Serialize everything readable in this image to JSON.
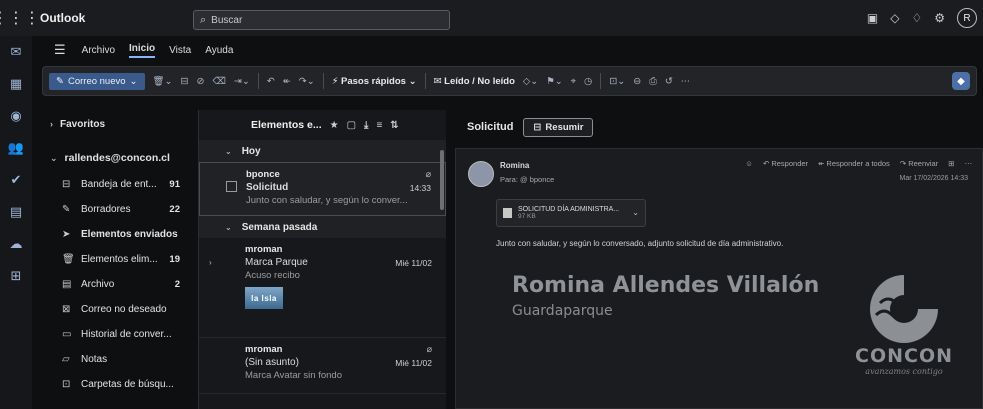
{
  "header": {
    "app_title": "Outlook",
    "search_placeholder": "Buscar",
    "avatar_initial": "R"
  },
  "menu": {
    "tabs": [
      "Archivo",
      "Inicio",
      "Vista",
      "Ayuda"
    ],
    "active_tab": "Inicio"
  },
  "ribbon": {
    "new_mail": "Correo nuevo",
    "quick_steps": "Pasos rápidos",
    "read_unread": "Leído / No leído"
  },
  "folders": {
    "favorites": "Favoritos",
    "account": "rallendes@concon.cl",
    "items": [
      {
        "label": "Bandeja de ent...",
        "count": "91",
        "icon": "inbox-icon"
      },
      {
        "label": "Borradores",
        "count": "22",
        "icon": "drafts-icon"
      },
      {
        "label": "Elementos enviados",
        "count": "",
        "icon": "sent-icon"
      },
      {
        "label": "Elementos elim...",
        "count": "19",
        "icon": "trash-icon"
      },
      {
        "label": "Archivo",
        "count": "2",
        "icon": "archive-icon"
      },
      {
        "label": "Correo no deseado",
        "count": "",
        "icon": "junk-icon"
      },
      {
        "label": "Historial de conver...",
        "count": "",
        "icon": "history-icon"
      },
      {
        "label": "Notas",
        "count": "",
        "icon": "notes-icon"
      },
      {
        "label": "Carpetas de búsqu...",
        "count": "",
        "icon": "search-folder-icon"
      }
    ]
  },
  "message_list": {
    "title": "Elementos e...",
    "groups": [
      {
        "label": "Hoy",
        "messages": [
          {
            "sender": "bponce",
            "subject": "Solicitud",
            "time": "14:33",
            "preview": "Junto con saludar, y según lo conver..."
          }
        ]
      },
      {
        "label": "Semana pasada",
        "messages": [
          {
            "sender": "mroman",
            "subject": "Marca Parque",
            "time": "Mié 11/02",
            "preview": "Acuso recibo",
            "thumb": "la Isla"
          },
          {
            "sender": "mroman",
            "subject": "(Sin asunto)",
            "time": "Mié 11/02",
            "preview": "Marca Avatar sin fondo"
          }
        ]
      }
    ]
  },
  "reading": {
    "subject": "Solicitud",
    "summarize": "Resumir",
    "from": "Romina",
    "to": "Para: @ bponce",
    "actions": [
      "Responder",
      "Responder a todos",
      "Reenviar"
    ],
    "date": "Mar 17/02/2026 14:33",
    "attachment_name": "SOLICITUD DÍA ADMINISTRA...",
    "attachment_size": "97 KB",
    "body": "Junto con saludar, y según lo conversado, adjunto solicitud de día administrativo.",
    "signature_name": "Romina Allendes Villalón",
    "signature_role": "Guardaparque",
    "logo_title": "CONCON",
    "logo_sub": "avanzamos contigo"
  }
}
